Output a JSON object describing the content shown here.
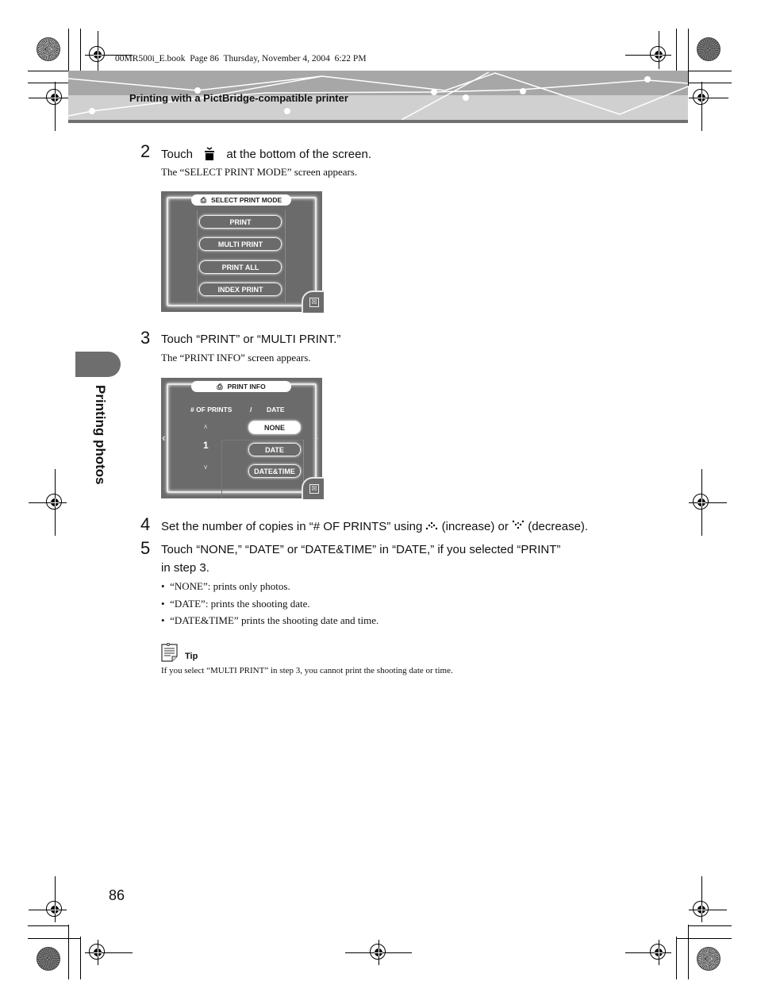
{
  "print_header": {
    "book_line": "00MR500i_E.book  Page 86  Thursday, November 4, 2004  6:22 PM"
  },
  "header": {
    "section_title": "Printing with a PictBridge-compatible printer"
  },
  "side_tab": {
    "label": "Printing photos"
  },
  "steps": {
    "s2": {
      "number": "2",
      "text_before": "Touch",
      "icon": "print-icon",
      "text_after": "at the bottom of the screen.",
      "sub": "The “SELECT PRINT MODE” screen appears."
    },
    "s3": {
      "number": "3",
      "text": "Touch “PRINT” or “MULTI PRINT.”",
      "sub": "The “PRINT INFO” screen appears."
    },
    "s4": {
      "number": "4",
      "text_a": "Set the number of copies in “# OF PRINTS” using",
      "icon_increase": "increase-icon",
      "text_b": "(increase) or",
      "icon_decrease": "decrease-icon",
      "text_c": "(decrease)."
    },
    "s5": {
      "number": "5",
      "line1": "Touch “NONE,” “DATE” or “DATE&TIME” in “DATE,” if you selected “PRINT”",
      "line2": "in step 3.",
      "bullets": [
        "“NONE”: prints only photos.",
        "“DATE”: prints the shooting date.",
        "“DATE&TIME” prints the shooting date and time."
      ]
    }
  },
  "select_print_mode_screen": {
    "title": "SELECT PRINT MODE",
    "buttons": [
      "PRINT",
      "MULTI PRINT",
      "PRINT ALL",
      "INDEX PRINT"
    ],
    "close": "☒"
  },
  "print_info_screen": {
    "title": "PRINT INFO",
    "col_prints": "# OF PRINTS",
    "divider": "/",
    "col_date": "DATE",
    "count": "1",
    "up": "∧",
    "down": "∨",
    "left_arrow": "‹",
    "right_arrow": "›",
    "date_options": [
      "NONE",
      "DATE",
      "DATE&TIME"
    ],
    "selected_option": "NONE",
    "close": "☒"
  },
  "tip": {
    "label": "Tip",
    "text": "If you select “MULTI PRINT” in step 3, you cannot print the shooting date or time."
  },
  "page_number": "86"
}
